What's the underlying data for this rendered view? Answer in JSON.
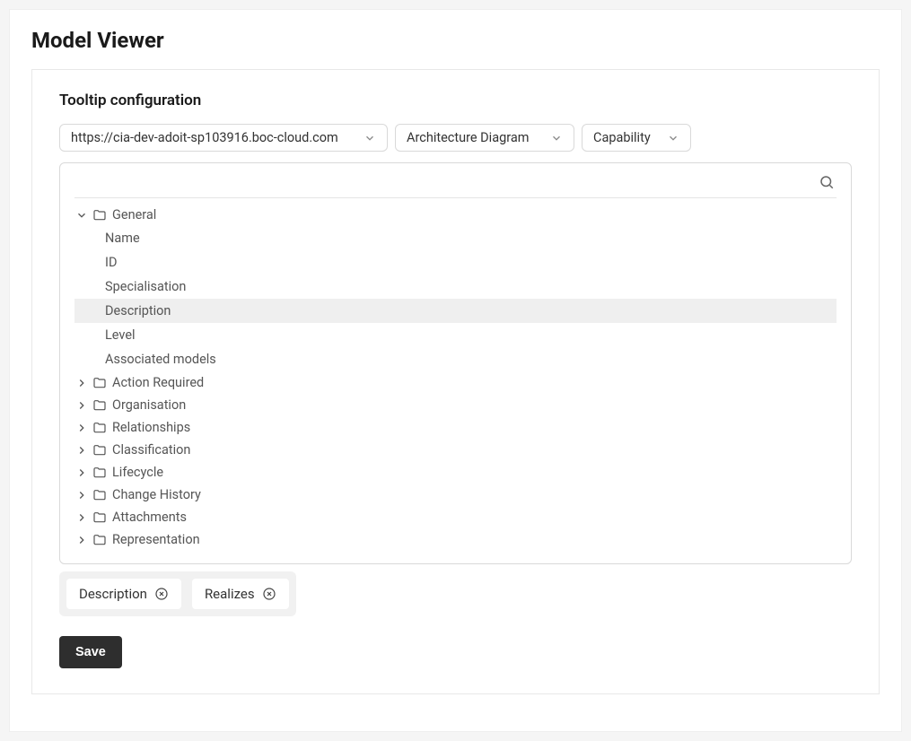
{
  "page": {
    "title": "Model Viewer"
  },
  "section": {
    "title": "Tooltip configuration"
  },
  "selects": {
    "url": "https://cia-dev-adoit-sp103916.boc-cloud.com",
    "diagram": "Architecture Diagram",
    "capability": "Capability"
  },
  "tree": {
    "general": {
      "label": "General",
      "items": {
        "name": "Name",
        "id": "ID",
        "specialisation": "Specialisation",
        "description": "Description",
        "level": "Level",
        "associated_models": "Associated models"
      }
    },
    "action_required": "Action Required",
    "organisation": "Organisation",
    "relationships": "Relationships",
    "classification": "Classification",
    "lifecycle": "Lifecycle",
    "change_history": "Change History",
    "attachments": "Attachments",
    "representation": "Representation"
  },
  "chips": {
    "description": "Description",
    "realizes": "Realizes"
  },
  "buttons": {
    "save": "Save"
  }
}
